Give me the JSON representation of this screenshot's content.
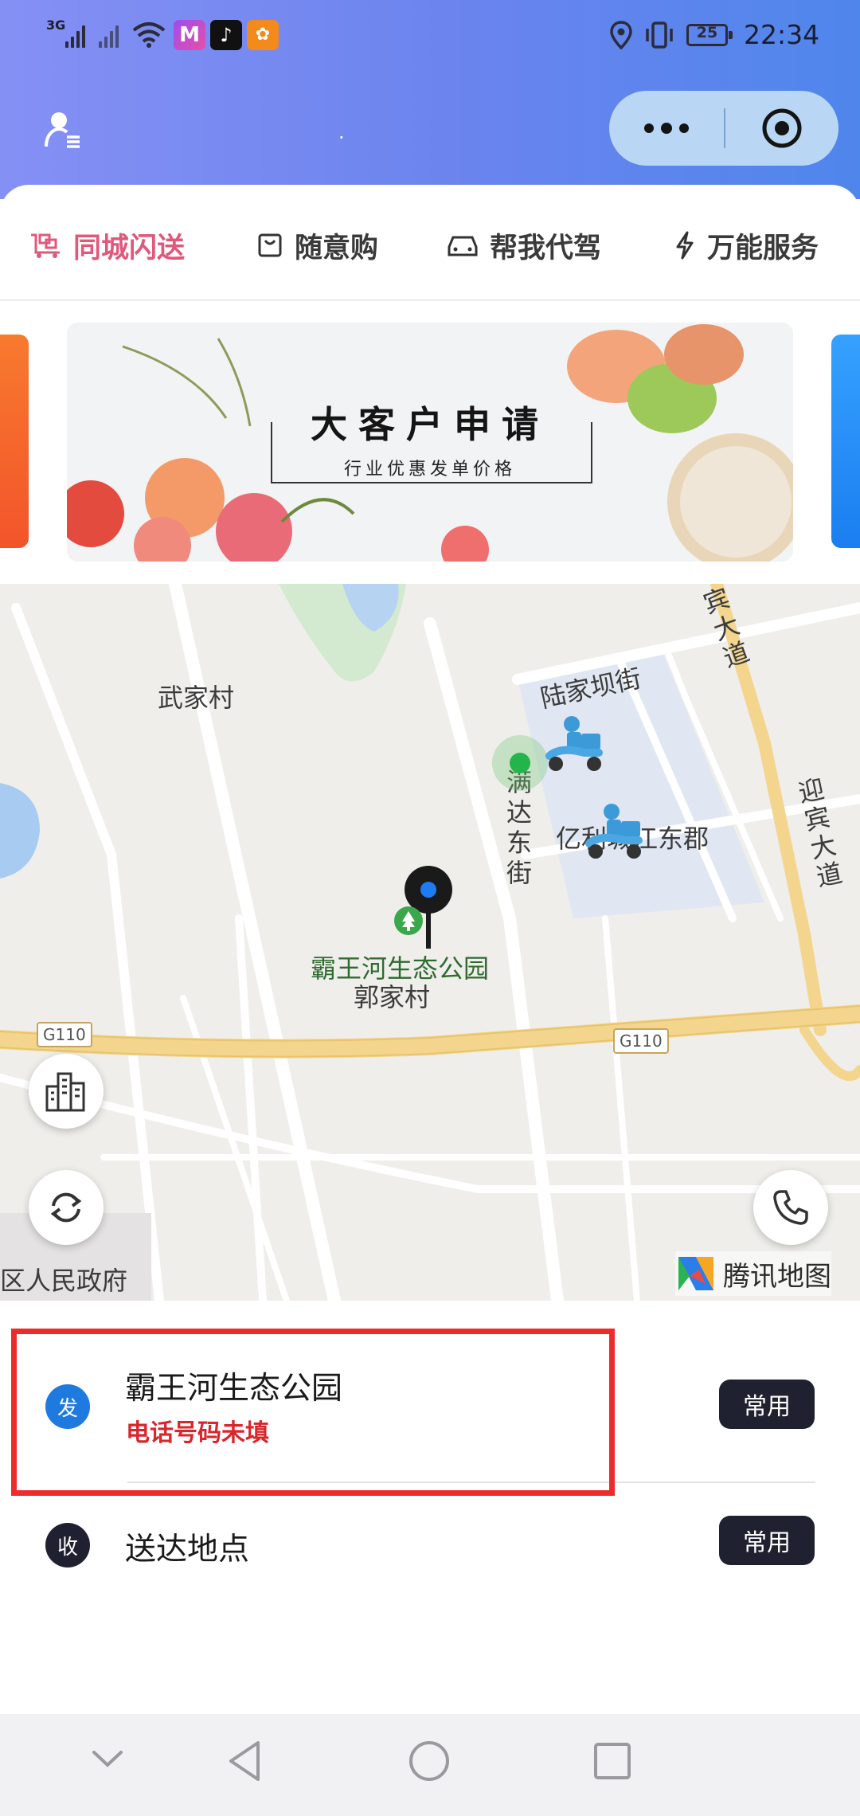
{
  "status_bar": {
    "network": "3G",
    "battery": "25",
    "time": "22:34"
  },
  "header": {
    "title": "."
  },
  "tabs": [
    {
      "label": "同城闪送",
      "active": true
    },
    {
      "label": "随意购",
      "active": false
    },
    {
      "label": "帮我代驾",
      "active": false
    },
    {
      "label": "万能服务",
      "active": false
    }
  ],
  "banner": {
    "title": "大客户申请",
    "subtitle": "行业优惠发单价格"
  },
  "map": {
    "labels": {
      "wujia": "武家村",
      "lujiaba": "陆家坝街",
      "manda": "满达东街",
      "bawanghe": "霸王河生态公园",
      "yili": "亿利城江东郡",
      "yingbin_top": "宾大道",
      "yingbin_right": "迎宾大道",
      "guojia": "郭家村",
      "gov": "区人民政府",
      "g110_left": "G110",
      "g110_right": "G110"
    },
    "provider": "腾讯地图"
  },
  "sender": {
    "badge": "发",
    "name": "霸王河生态公园",
    "warning": "电话号码未填",
    "action": "常用"
  },
  "receiver": {
    "badge": "收",
    "placeholder": "送达地点",
    "action": "常用"
  },
  "colors": {
    "accent_pink": "#e0587a",
    "sender_blue": "#1f7ae0",
    "receiver_dark": "#1f2130",
    "warning_red": "#d8262a",
    "highlight_red": "#ee2b2b"
  }
}
